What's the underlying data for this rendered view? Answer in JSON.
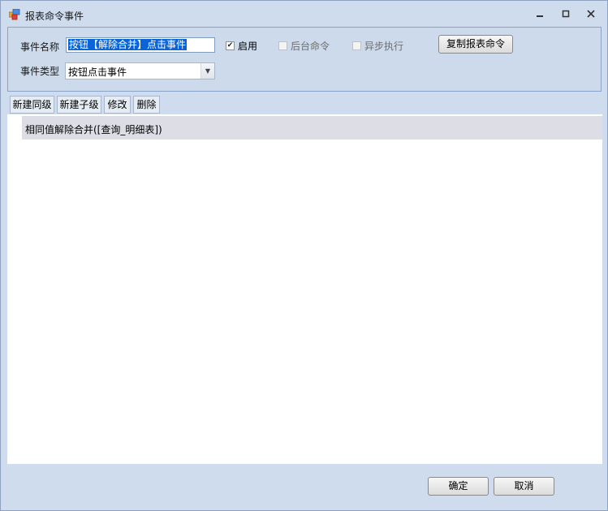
{
  "window": {
    "title": "报表命令事件"
  },
  "form": {
    "event_name_label": "事件名称",
    "event_name_value": "按钮【解除合并】点击事件",
    "enabled_label": "启用",
    "enabled_checked": true,
    "background_label": "后台命令",
    "background_checked": false,
    "async_label": "异步执行",
    "async_checked": false,
    "copy_button_label": "复制报表命令",
    "event_type_label": "事件类型",
    "event_type_value": "按钮点击事件"
  },
  "toolbar": {
    "new_sibling": "新建同级",
    "new_child": "新建子级",
    "modify": "修改",
    "delete": "删除"
  },
  "list": {
    "items": [
      {
        "label": "相同值解除合并([查询_明细表])"
      }
    ]
  },
  "footer": {
    "ok_label": "确定",
    "cancel_label": "取消"
  },
  "icons": {
    "app": "app-window-icon",
    "minimize": "minimize-icon",
    "maximize": "maximize-icon",
    "close": "close-icon",
    "dropdown": "chevron-down-icon"
  }
}
